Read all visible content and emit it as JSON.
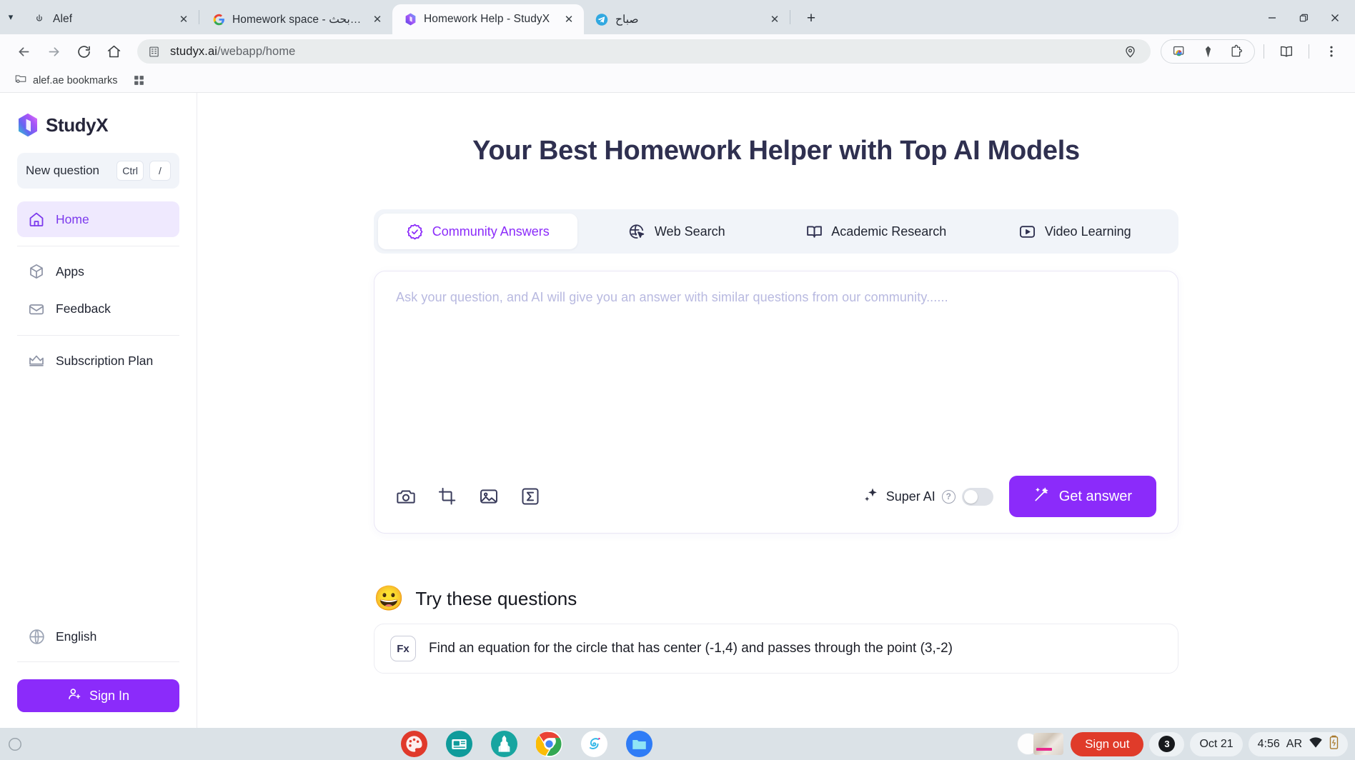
{
  "browser": {
    "tabs": [
      {
        "title": "Alef",
        "favicon": "alef-icon",
        "active": false
      },
      {
        "title": "Homework space - بحث Google",
        "favicon": "google-icon",
        "active": false
      },
      {
        "title": "Homework Help - StudyX",
        "favicon": "studyx-icon",
        "active": true
      },
      {
        "title": "صباح",
        "favicon": "telegram-icon",
        "active": false
      }
    ],
    "new_tab_label": "+",
    "window_controls": {
      "minimize": "minimize-icon",
      "maximize": "restore-icon",
      "close": "close-icon"
    },
    "toolbar": {
      "back": "back-arrow-icon",
      "forward": "forward-arrow-icon",
      "reload": "reload-icon",
      "home": "home-icon",
      "site_icon": "enterprise-building-icon",
      "url_domain": "studyx.ai",
      "url_path": "/webapp/home",
      "location_icon": "location-pin-icon",
      "extension_icons": [
        "chrome-cast-icon",
        "gem-icon",
        "puzzle-extensions-icon"
      ],
      "reading_list_icon": "book-icon",
      "menu_icon": "three-dot-menu-icon"
    },
    "bookmarks": {
      "items": [
        {
          "label": "alef.ae bookmarks",
          "icon": "folder-gear-icon"
        }
      ],
      "apps_icon": "grid-apps-icon"
    }
  },
  "sidebar": {
    "brand": "StudyX",
    "new_question": {
      "label": "New question",
      "key1": "Ctrl",
      "key2": "/"
    },
    "items": [
      {
        "label": "Home",
        "icon": "home-icon",
        "active": true
      },
      {
        "label": "Apps",
        "icon": "cube-icon",
        "active": false
      },
      {
        "label": "Feedback",
        "icon": "envelope-icon",
        "active": false
      },
      {
        "label": "Subscription Plan",
        "icon": "crown-icon",
        "active": false
      }
    ],
    "language": {
      "label": "English",
      "icon": "globe-icon"
    },
    "sign_in": {
      "label": "Sign In",
      "icon": "user-plus-icon"
    }
  },
  "main": {
    "hero_title": "Your Best Homework Helper with Top AI Models",
    "mode_tabs": [
      {
        "label": "Community Answers",
        "icon": "badge-check-icon",
        "active": true
      },
      {
        "label": "Web Search",
        "icon": "globe-cursor-icon",
        "active": false
      },
      {
        "label": "Academic Research",
        "icon": "open-book-icon",
        "active": false
      },
      {
        "label": "Video Learning",
        "icon": "video-play-icon",
        "active": false
      }
    ],
    "composer": {
      "placeholder": "Ask your question, and AI will give you an answer with similar questions from our community......",
      "value": "",
      "tools": [
        {
          "icon": "camera-icon"
        },
        {
          "icon": "crop-icon"
        },
        {
          "icon": "image-icon"
        },
        {
          "icon": "sigma-math-icon"
        }
      ],
      "super_ai": {
        "label": "Super AI",
        "icon": "sparkle-icon",
        "help": "?",
        "enabled": false
      },
      "get_answer": {
        "label": "Get answer",
        "icon": "magic-wand-icon"
      }
    },
    "try_section": {
      "emoji": "😀",
      "title": "Try these questions",
      "questions": [
        {
          "badge": "Fx",
          "text": "Find an equation for the circle that has center (-1,4) and passes through the point (3,-2)"
        }
      ]
    }
  },
  "taskbar": {
    "apps": [
      {
        "name": "paint-app-icon",
        "color": "#e0392b"
      },
      {
        "name": "news-app-icon",
        "color": "#0f9b9b"
      },
      {
        "name": "building-app-icon",
        "color": "#17a5a0"
      },
      {
        "name": "chrome-app-icon",
        "color": "#4285f4"
      },
      {
        "name": "swirl-app-icon",
        "color": "#ffffff"
      },
      {
        "name": "files-app-icon",
        "color": "#2f7cf6"
      }
    ],
    "sign_out": "Sign out",
    "notification_count": "3",
    "date": "Oct 21",
    "time": "4:56",
    "locale": "AR",
    "wifi_icon": "wifi-icon",
    "battery_icon": "battery-charging-icon"
  },
  "colors": {
    "accent_purple": "#8b2bfa",
    "accent_purple_light": "#efe9fe",
    "heading_navy": "#2f3050",
    "sign_out_red": "#e03b2a"
  }
}
